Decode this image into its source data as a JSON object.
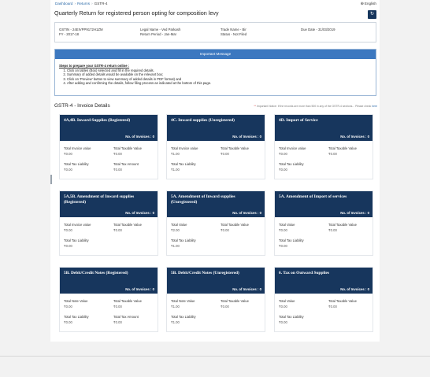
{
  "breadcrumb": {
    "dashboard": "Dashboard",
    "returns": "Returns",
    "current": "GSTR-4",
    "sep": "›"
  },
  "language": {
    "label": "English",
    "icon": "globe-icon"
  },
  "page_title": "Quarterly Return for registered person opting for composition levy",
  "refresh_icon": "↻",
  "taxpayer": {
    "gstin": "GSTIN - 24EIVPP9172H1ZM",
    "fy": "FY - 2017-18",
    "legal_name": "Legal Name - Ved Parkash",
    "return_period": "Return Period - Jan-Mar",
    "trade_name": "Trade Name - Bir",
    "status": "Status - Not Filed",
    "due_date": "Due Date - 31/03/2019"
  },
  "important_message": {
    "heading": "Important Message",
    "lead": "Steps to prepare your GSTR-4 return online :",
    "steps": [
      "Click on tables (Box) selected and fill in the required details.",
      "Summary of added details would be available on the relevant box;",
      "Click on 'Preview' button to view summary of added details in PDF format) and",
      "After adding and confirming the details, follow filing process as indicated at the bottom of this page."
    ]
  },
  "invoice_section": {
    "title": "GSTR-4 - Invoice Details",
    "note_mark": "**",
    "note": "Important Notice: If the records are more than 500 in any of the GSTR-4 sections... Please check",
    "note_link": "here"
  },
  "tiles": [
    {
      "title": "4A,4B. Inward Supplies (Registered)",
      "count": "No. of Invoices : 0",
      "f1_label": "Total Invoice value",
      "f1_value": "₹0.00",
      "f2_label": "Total Taxable Value",
      "f2_value": "₹0.00",
      "f3_label": "Total Tax Liability",
      "f3_value": "₹0.00",
      "f4_label": "Total Tax Amount",
      "f4_value": "₹0.00"
    },
    {
      "title": "4C. Inward supplies (Unregistered)",
      "count": "No. of Invoices : 0",
      "f1_label": "Total Invoice value",
      "f1_value": "₹1.00",
      "f2_label": "Total Taxable Value",
      "f2_value": "₹0.00",
      "f3_label": "Total Tax Liability",
      "f3_value": "₹1.00",
      "f4_label": "",
      "f4_value": ""
    },
    {
      "title": "4D. Import of Service",
      "count": "No. of Invoices : 0",
      "f1_label": "Total Invoice value",
      "f1_value": "₹0.00",
      "f2_label": "Total Taxable Value",
      "f2_value": "₹0.00",
      "f3_label": "Total Tax Liability",
      "f3_value": "₹0.00",
      "f4_label": "",
      "f4_value": ""
    },
    {
      "title": "5A,5B. Amendment of Inward supplies (Registered)",
      "count": "No. of Invoices : 0",
      "f1_label": "Total Invoice value",
      "f1_value": "₹0.00",
      "f2_label": "Total Taxable Value",
      "f2_value": "₹0.00",
      "f3_label": "Total Tax Liability",
      "f3_value": "₹0.00",
      "f4_label": "",
      "f4_value": ""
    },
    {
      "title": "5A. Amendment of Inward supplies (Unregistered)",
      "count": "No. of Invoices : 0",
      "f1_label": "Total Value",
      "f1_value": "₹2.00",
      "f2_label": "Total Taxable Value",
      "f2_value": "₹0.00",
      "f3_label": "Total Tax Liability",
      "f3_value": "₹1.00",
      "f4_label": "",
      "f4_value": ""
    },
    {
      "title": "5A. Amendment of Import of services",
      "count": "No. of Invoices : 0",
      "f1_label": "Total Value",
      "f1_value": "₹0.00",
      "f2_label": "Total Taxable Value",
      "f2_value": "₹0.00",
      "f3_label": "Total Tax Liability",
      "f3_value": "₹0.00",
      "f4_label": "",
      "f4_value": ""
    },
    {
      "title": "5B. Debit/Credit Notes (Registered)",
      "count": "No. of Invoices : 0",
      "f1_label": "Total Note Value",
      "f1_value": "₹0.00",
      "f2_label": "Total Taxable Value",
      "f2_value": "₹0.00",
      "f3_label": "Total Tax Liability",
      "f3_value": "₹0.00",
      "f4_label": "Total Tax Amount",
      "f4_value": "₹0.00"
    },
    {
      "title": "5B. Debit/Credit Notes (Unregistered)",
      "count": "No. of Invoices : 0",
      "f1_label": "Total Note Value",
      "f1_value": "₹1.00",
      "f2_label": "Total Taxable Value",
      "f2_value": "₹0.00",
      "f3_label": "Total Tax Liability",
      "f3_value": "₹1.00",
      "f4_label": "",
      "f4_value": ""
    },
    {
      "title": "6. Tax on Outward Supplies",
      "count": "No. of Invoices : 0",
      "f1_label": "Total Value",
      "f1_value": "₹0.00",
      "f2_label": "Total Taxable Value",
      "f2_value": "₹0.00",
      "f3_label": "Total Tax Liability",
      "f3_value": "₹0.00",
      "f4_label": "",
      "f4_value": ""
    }
  ]
}
